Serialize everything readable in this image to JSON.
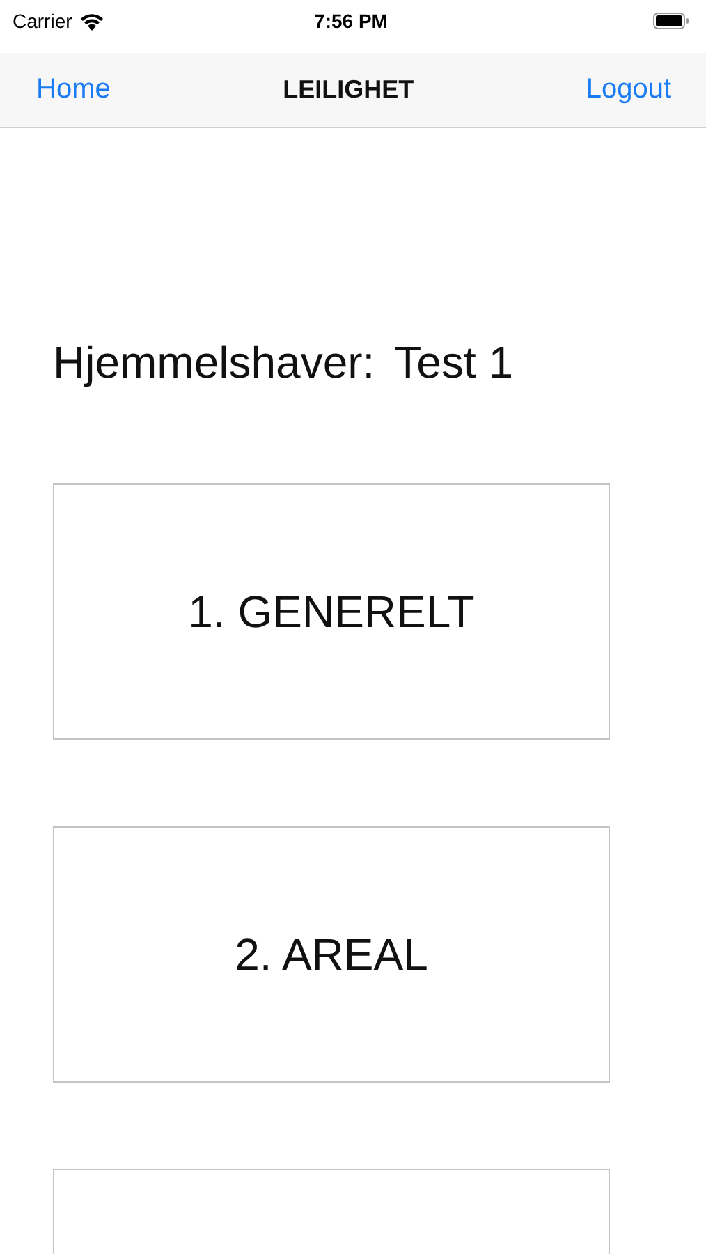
{
  "status_bar": {
    "carrier": "Carrier",
    "time": "7:56 PM"
  },
  "nav_bar": {
    "left": "Home",
    "title": "LEILIGHET",
    "right": "Logout"
  },
  "owner": {
    "label": "Hjemmelshaver:",
    "value": "Test 1"
  },
  "cards": [
    {
      "kind": "labeled",
      "label": "1. GENERELT"
    },
    {
      "kind": "labeled",
      "label": "2. AREAL"
    },
    {
      "kind": "blank"
    }
  ]
}
